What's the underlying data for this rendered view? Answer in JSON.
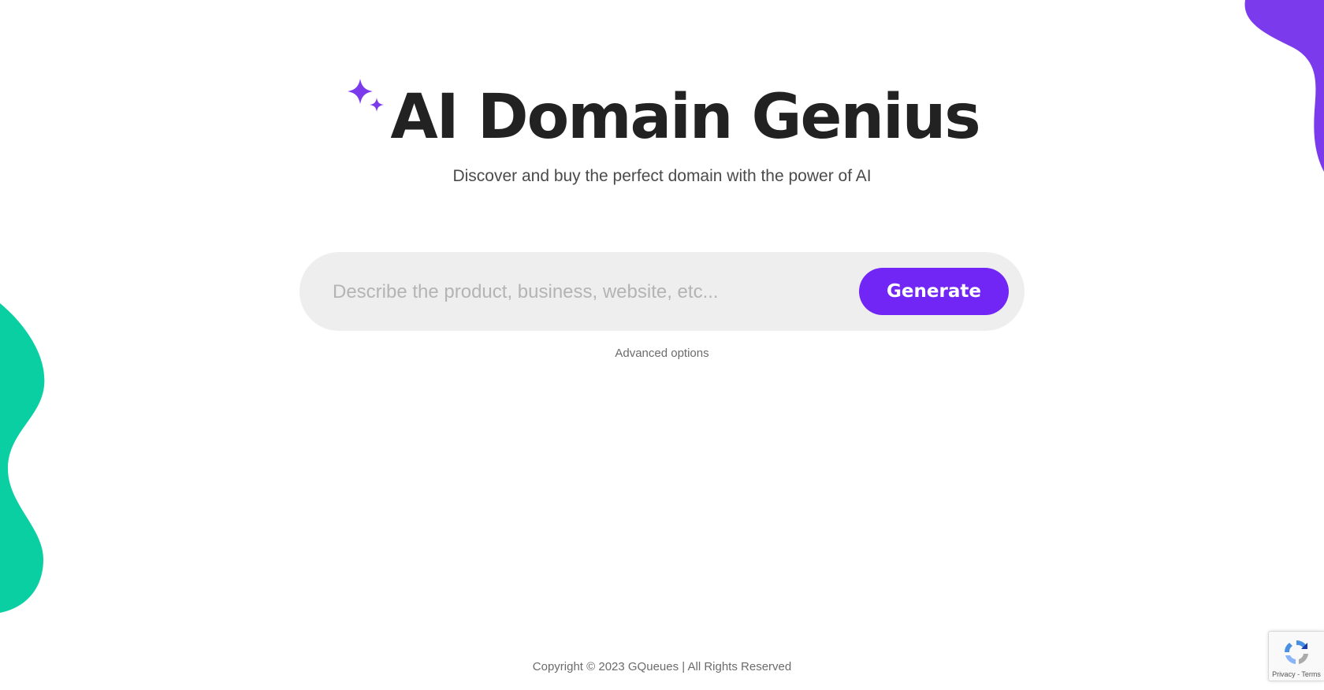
{
  "app": {
    "title": "AI Domain Genius",
    "subtitle": "Discover and buy the perfect domain with the power of AI"
  },
  "search": {
    "placeholder": "Describe the product, business, website, etc...",
    "value": "",
    "button_label": "Generate"
  },
  "advanced_options_label": "Advanced options",
  "footer": {
    "copyright": "Copyright © 2023 GQueues | All Rights Reserved"
  },
  "recaptcha": {
    "privacy": "Privacy",
    "separator": " - ",
    "terms": "Terms"
  },
  "icons": {
    "title_icon": "sparkle-icon",
    "recaptcha_icon": "recaptcha-logo-icon"
  },
  "colors": {
    "accent": "#7126f5",
    "title_text": "#222222",
    "blob_top_right": "#7c3aed",
    "blob_left": "#0acfa3",
    "search_bg": "#eeeeee"
  }
}
